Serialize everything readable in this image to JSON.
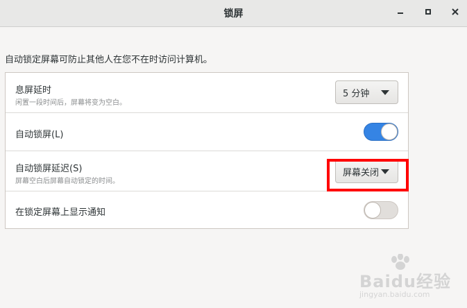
{
  "window": {
    "title": "锁屏"
  },
  "description": "自动锁定屏幕可防止其他人在您不在时访问计算机。",
  "rows": [
    {
      "title": "息屏延时",
      "subtitle": "闲置一段时间后，屏幕将变为空白。",
      "control": "dropdown",
      "value": "5 分钟"
    },
    {
      "title": "自动锁屏(L)",
      "control": "switch",
      "value": "on"
    },
    {
      "title": "自动锁屏延迟(S)",
      "subtitle": "屏幕空白后屏幕自动锁定的时间。",
      "control": "dropdown",
      "value": "屏幕关闭"
    },
    {
      "title": "在锁定屏幕上显示通知",
      "control": "switch",
      "value": "off"
    }
  ],
  "annotation": {
    "highlight_color": "#ff0000"
  },
  "colors": {
    "switch_on": "#3584e4",
    "switch_off": "#e1dedb"
  },
  "watermark": {
    "text": "Baidu经验",
    "url": "jingyan.baidu.com"
  }
}
